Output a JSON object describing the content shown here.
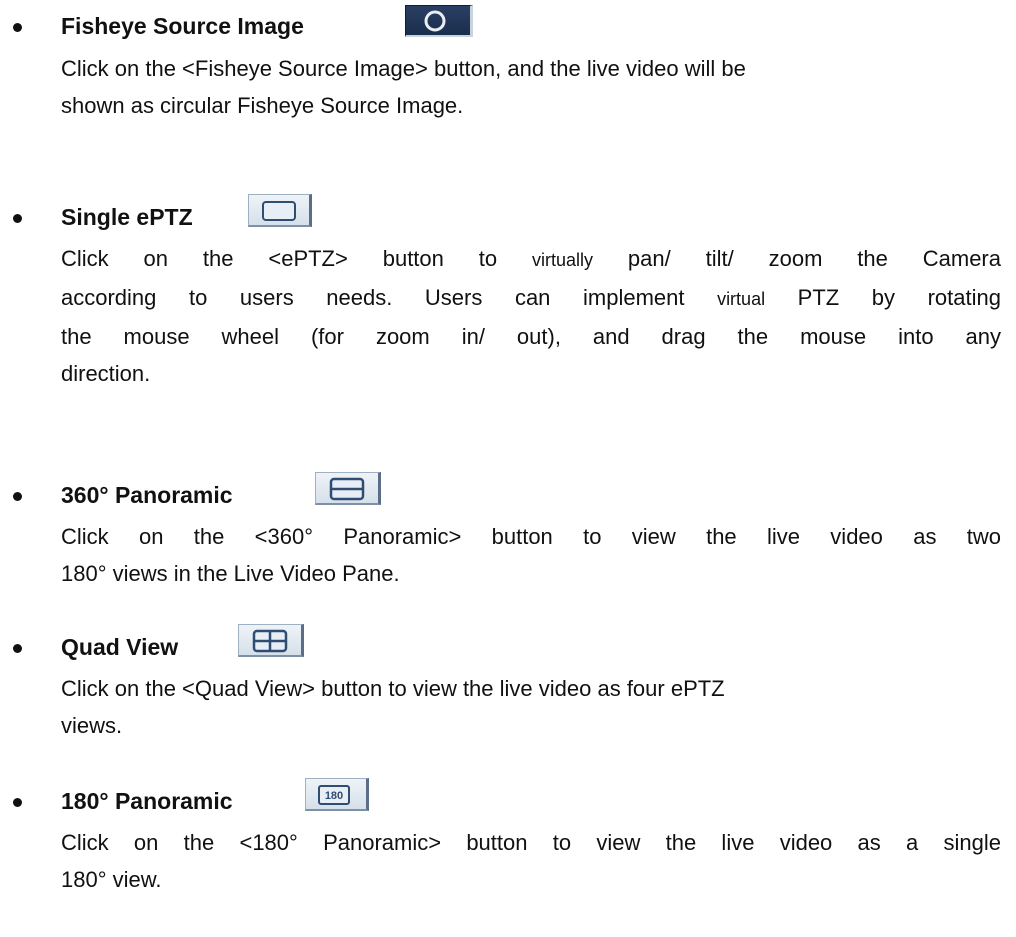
{
  "items": [
    {
      "title": "Fisheye Source Image",
      "icon": "fisheye-circle-icon",
      "lines": [
        "Click on the <Fisheye Source Image> button, and the live video will be",
        "shown as circular Fisheye Source Image."
      ]
    },
    {
      "title": "Single ePTZ",
      "icon": "single-view-icon",
      "lines": [
        {
          "a": "Click on the <ePTZ> button to ",
          "b": "virtually",
          "c": " pan/ tilt/ zoom the Camera"
        },
        {
          "a": "according to users needs. Users can implement ",
          "b": "virtual",
          "c": " PTZ by rotating"
        },
        "the mouse wheel (for zoom in/ out), and drag the mouse into any",
        "direction."
      ]
    },
    {
      "title": "360° Panoramic",
      "icon": "dual-panoramic-icon",
      "lines": [
        "Click on the <360° Panoramic> button to view the live video as two",
        "180° views in the Live Video Pane."
      ]
    },
    {
      "title": "Quad View",
      "icon": "quad-view-icon",
      "lines": [
        "Click on the <Quad View> button to view the live video as four ePTZ",
        "views."
      ]
    },
    {
      "title": "180° Panoramic",
      "icon": "panoramic-180-icon",
      "icon_text": "180",
      "lines": [
        "Click on the <180° Panoramic> button to view the live video as a single",
        "180° view."
      ]
    }
  ],
  "colors": {
    "text": "#111111",
    "icon_fill": "#1a2f4d",
    "button_bg": "#dde6ef"
  }
}
